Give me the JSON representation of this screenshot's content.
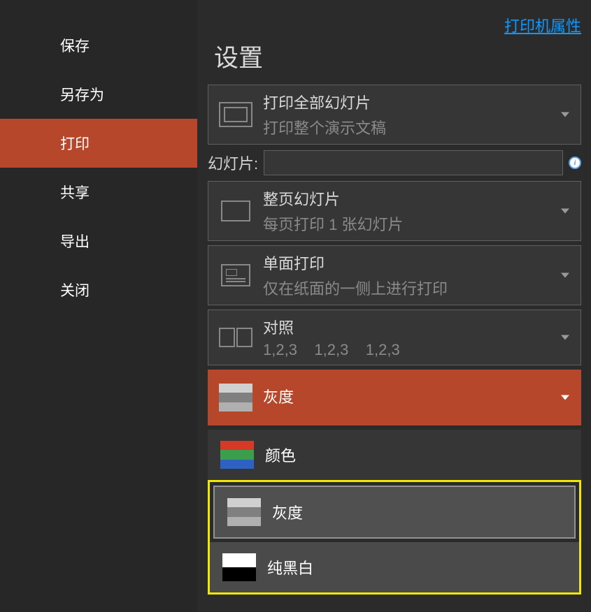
{
  "sidebar": {
    "items": [
      {
        "label": "保存"
      },
      {
        "label": "另存为"
      },
      {
        "label": "打印"
      },
      {
        "label": "共享"
      },
      {
        "label": "导出"
      },
      {
        "label": "关闭"
      }
    ],
    "activeIndex": 2
  },
  "main": {
    "printerPropertiesLink": "打印机属性",
    "settingsTitle": "设置",
    "printWhat": {
      "title": "打印全部幻灯片",
      "subtitle": "打印整个演示文稿"
    },
    "slidesLabel": "幻灯片:",
    "layout": {
      "title": "整页幻灯片",
      "subtitle": "每页打印 1 张幻灯片"
    },
    "sides": {
      "title": "单面打印",
      "subtitle": "仅在纸面的一侧上进行打印"
    },
    "collate": {
      "title": "对照",
      "subtitle": "1,2,3    1,2,3    1,2,3"
    },
    "colorMode": {
      "title": "灰度"
    },
    "colorOptions": {
      "color": "颜色",
      "grayscale": "灰度",
      "blackwhite": "纯黑白"
    }
  }
}
